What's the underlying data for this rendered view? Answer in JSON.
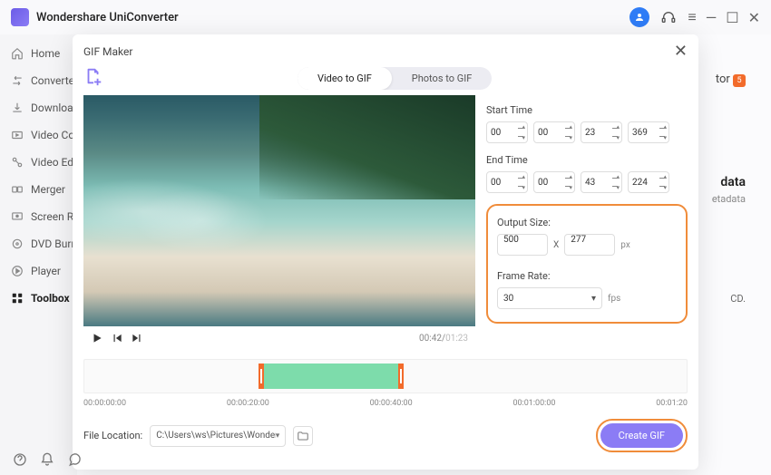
{
  "app": {
    "name": "Wondershare UniConverter"
  },
  "sidebar": {
    "items": [
      {
        "label": "Home"
      },
      {
        "label": "Converter"
      },
      {
        "label": "Downloader"
      },
      {
        "label": "Video Compressor"
      },
      {
        "label": "Video Editor"
      },
      {
        "label": "Merger"
      },
      {
        "label": "Screen Recorder"
      },
      {
        "label": "DVD Burner"
      },
      {
        "label": "Player"
      },
      {
        "label": "Toolbox"
      }
    ]
  },
  "ghost": {
    "rightword1": "tor",
    "rightword2": "data",
    "rightword3": "etadata",
    "rightword4": "CD."
  },
  "modal": {
    "title": "GIF Maker",
    "tabs": {
      "a": "Video to GIF",
      "b": "Photos to GIF"
    },
    "time": {
      "start_label": "Start Time",
      "end_label": "End Time",
      "start": [
        "00",
        "00",
        "23",
        "369"
      ],
      "end": [
        "00",
        "00",
        "43",
        "224"
      ]
    },
    "output": {
      "label": "Output Size:",
      "w": "500",
      "h": "277",
      "x": "X",
      "px": "px",
      "frame_label": "Frame Rate:",
      "frame": "30",
      "fps": "fps"
    },
    "player": {
      "current": "00:42",
      "total": "01:23"
    },
    "ruler": [
      "00:00:00:00",
      "00:00:20:00",
      "00:00:40:00",
      "00:01:00:00",
      "00:01:20"
    ],
    "file": {
      "label": "File Location:",
      "path": "C:\\Users\\ws\\Pictures\\Wonders"
    },
    "create": "Create GIF"
  }
}
